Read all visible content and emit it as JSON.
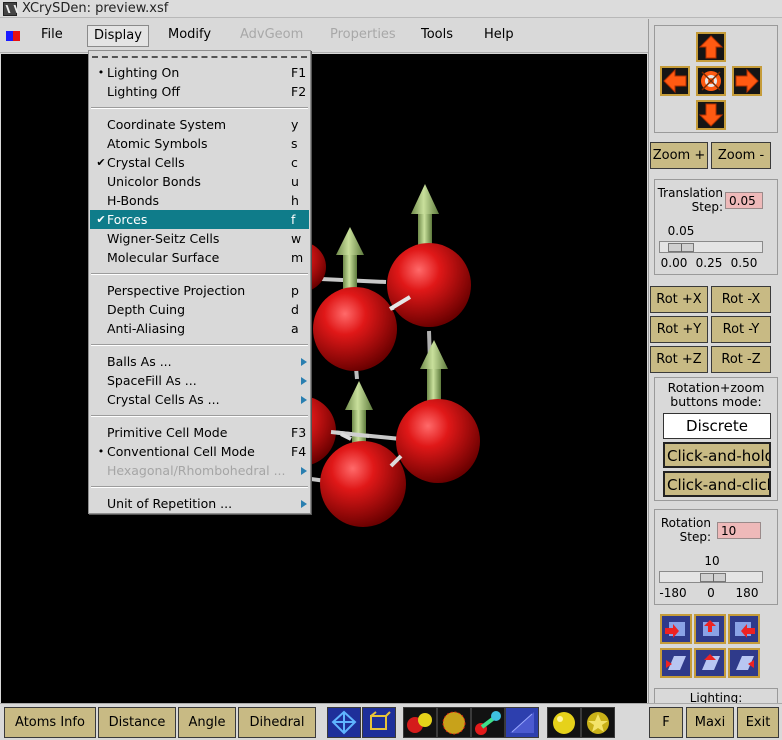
{
  "window": {
    "title": "XCrySDen: preview.xsf"
  },
  "menubar": {
    "items": [
      {
        "label": "File",
        "state": "normal"
      },
      {
        "label": "Display",
        "state": "active"
      },
      {
        "label": "Modify",
        "state": "normal"
      },
      {
        "label": "AdvGeom",
        "state": "disabled"
      },
      {
        "label": "Properties",
        "state": "disabled"
      },
      {
        "label": "Tools",
        "state": "normal"
      },
      {
        "label": "Help",
        "state": "normal"
      }
    ]
  },
  "display_menu": {
    "lighting_on": {
      "label": "Lighting On",
      "accel": "F1"
    },
    "lighting_off": {
      "label": "Lighting Off",
      "accel": "F2"
    },
    "coordinate_system": {
      "label": "Coordinate System",
      "accel": "y"
    },
    "atomic_symbols": {
      "label": "Atomic Symbols",
      "accel": "s"
    },
    "crystal_cells": {
      "label": "Crystal Cells",
      "accel": "c"
    },
    "unicolor_bonds": {
      "label": "Unicolor Bonds",
      "accel": "u"
    },
    "h_bonds": {
      "label": "H-Bonds",
      "accel": "h"
    },
    "forces": {
      "label": "Forces",
      "accel": "f"
    },
    "wigner_seitz": {
      "label": "Wigner-Seitz Cells",
      "accel": "w"
    },
    "molecular_surface": {
      "label": "Molecular Surface",
      "accel": "m"
    },
    "perspective": {
      "label": "Perspective Projection",
      "accel": "p"
    },
    "depth_cuing": {
      "label": "Depth Cuing",
      "accel": "d"
    },
    "anti_aliasing": {
      "label": "Anti-Aliasing",
      "accel": "a"
    },
    "balls_as": {
      "label": "Balls As ..."
    },
    "spacefill_as": {
      "label": "SpaceFill As ..."
    },
    "crystal_cells_as": {
      "label": "Crystal Cells As ..."
    },
    "primitive_cell": {
      "label": "Primitive Cell Mode",
      "accel": "F3"
    },
    "conventional_cell": {
      "label": "Conventional Cell Mode",
      "accel": "F4"
    },
    "hex_rhombo": {
      "label": "Hexagonal/Rhombohedral ..."
    },
    "unit_of_repetition": {
      "label": "Unit of Repetition ..."
    },
    "radio_mark": "•",
    "check_mark": "✔"
  },
  "right_panel": {
    "zoom_plus": "Zoom +",
    "zoom_minus": "Zoom -",
    "translation_label": "Translation\nStep:",
    "translation_value": "0.05",
    "translation_scale": {
      "current": "0.05",
      "ticks": [
        "0.00",
        "0.25",
        "0.50"
      ],
      "fraction": 0.1
    },
    "rot_buttons": [
      "Rot +X",
      "Rot -X",
      "Rot +Y",
      "Rot -Y",
      "Rot +Z",
      "Rot -Z"
    ],
    "mode_label": "Rotation+zoom\nbuttons mode:",
    "mode_discrete": "Discrete",
    "mode_click_hold": "Click-and-hold",
    "mode_click_click": "Click-and-click",
    "rotation_label": "Rotation\nStep:",
    "rotation_value": "10",
    "rotation_scale": {
      "current": "10",
      "ticks": [
        "-180",
        "0",
        "180"
      ],
      "fraction": 0.528
    },
    "lighting_label": "Lighting:"
  },
  "bottom_bar": {
    "atoms_info": "Atoms Info",
    "distance": "Distance",
    "angle": "Angle",
    "dihedral": "Dihedral",
    "f": "F",
    "maxi": "Maxi",
    "exit": "Exit"
  },
  "colors": {
    "atom": "#d8141b",
    "force_arrow": "#a7c47a",
    "selection": "#0f7c8a",
    "button_tan": "#c8ba84",
    "arrow_orange": "#ff5a12"
  }
}
